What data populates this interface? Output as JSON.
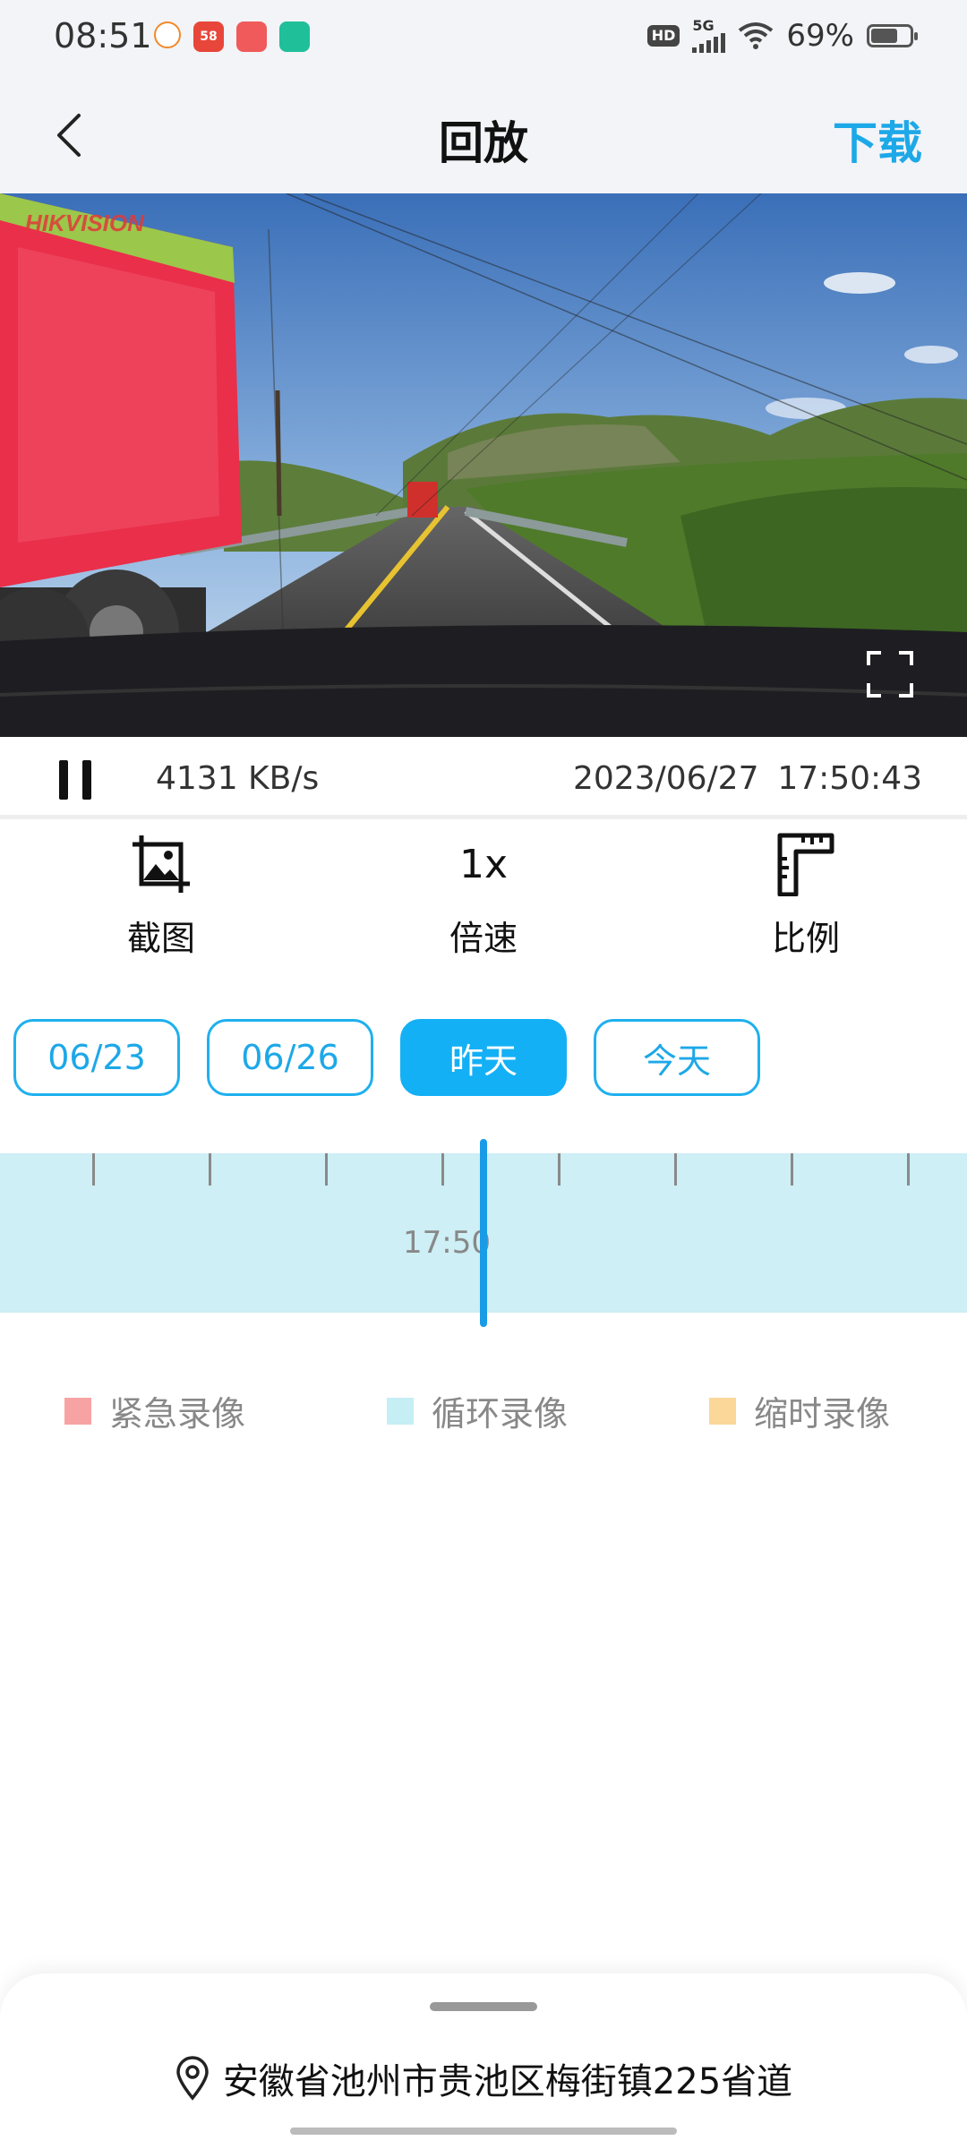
{
  "status_bar": {
    "time": "08:51",
    "network": "5G",
    "hd": "HD",
    "battery": "69%",
    "battery_level": 0.69,
    "apps": [
      {
        "name": "app-icon-1",
        "text": "",
        "color": "#ffffff"
      },
      {
        "name": "app-icon-58",
        "text": "58",
        "color": "#e8463a"
      },
      {
        "name": "app-icon-3",
        "text": "",
        "color": "#f05a5a"
      },
      {
        "name": "app-icon-4",
        "text": "",
        "color": "#1fbf9a"
      }
    ]
  },
  "nav": {
    "title": "回放",
    "download": "下载",
    "back_icon": "chevron-left-icon"
  },
  "video": {
    "watermark": "HIKVISION",
    "fullscreen_icon": "fullscreen-icon"
  },
  "playback": {
    "bitrate": "4131 KB/s",
    "date": "2023/06/27",
    "time": "17:50:43",
    "pause_icon": "pause-icon"
  },
  "tools": {
    "screenshot": {
      "label": "截图",
      "icon": "screenshot-icon"
    },
    "speed": {
      "value": "1x",
      "label": "倍速"
    },
    "ratio": {
      "label": "比例",
      "icon": "ratio-icon"
    }
  },
  "dates": [
    {
      "label": "06/23",
      "active": false
    },
    {
      "label": "06/26",
      "active": false
    },
    {
      "label": "昨天",
      "active": true
    },
    {
      "label": "今天",
      "active": false
    }
  ],
  "timeline": {
    "label": "17:50"
  },
  "legend": [
    {
      "label": "紧急录像",
      "color": "#f7a3a3"
    },
    {
      "label": "循环录像",
      "color": "#c6eef5"
    },
    {
      "label": "缩时录像",
      "color": "#fbd79a"
    }
  ],
  "location": {
    "text": "安徽省池州市贵池区梅街镇225省道",
    "icon": "location-pin-icon"
  },
  "colors": {
    "accent": "#1da8e8",
    "active_chip": "#14b0f5",
    "timeline_bg": "#cdeff5"
  }
}
